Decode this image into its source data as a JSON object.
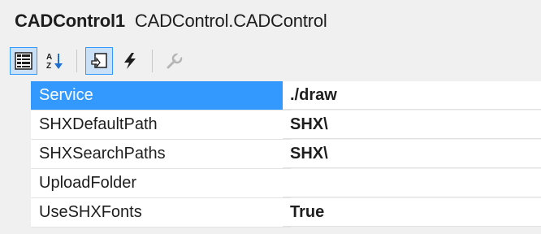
{
  "header": {
    "object_name": "CADControl1",
    "object_type": "CADControl.CADControl"
  },
  "toolbar": {
    "buttons": [
      {
        "icon": "categorized-icon",
        "checked": true
      },
      {
        "icon": "alphabetical-icon",
        "checked": false
      },
      {
        "icon": "properties-page-icon",
        "checked": true
      },
      {
        "icon": "events-lightning-icon",
        "checked": false
      },
      {
        "icon": "property-pages-wrench-icon",
        "checked": false,
        "disabled": true
      }
    ]
  },
  "properties": [
    {
      "name": "Service",
      "value": "./draw",
      "selected": true
    },
    {
      "name": "SHXDefaultPath",
      "value": "SHX\\",
      "selected": false
    },
    {
      "name": "SHXSearchPaths",
      "value": "SHX\\",
      "selected": false
    },
    {
      "name": "UploadFolder",
      "value": "",
      "selected": false
    },
    {
      "name": "UseSHXFonts",
      "value": "True",
      "selected": false
    }
  ],
  "colors": {
    "selection": "#3399ff",
    "background": "#f0f0f0"
  }
}
